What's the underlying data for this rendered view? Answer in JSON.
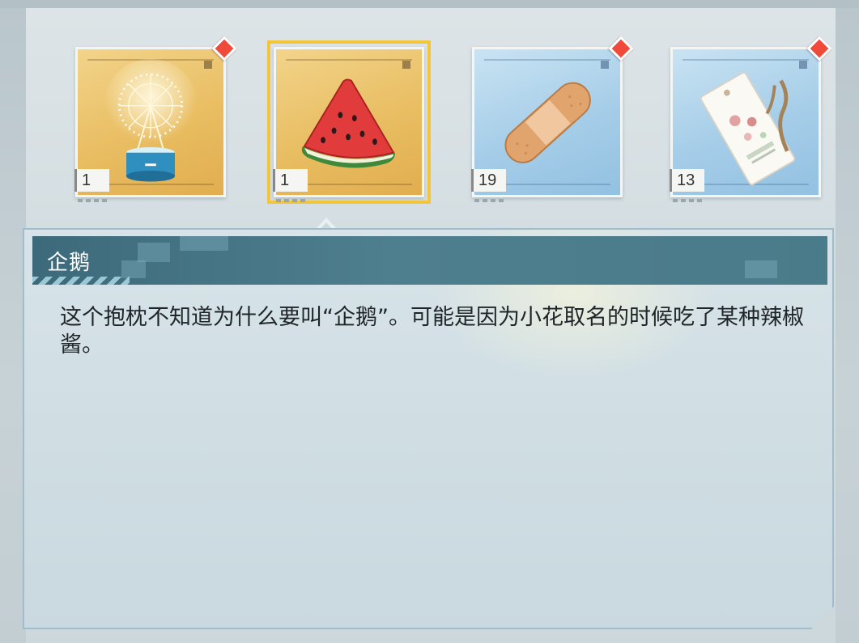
{
  "items": [
    {
      "name": "ferris-wheel-lamp",
      "count": "1",
      "rarity": "gold",
      "is_new": true,
      "selected": false
    },
    {
      "name": "watermelon-pillow",
      "count": "1",
      "rarity": "gold",
      "is_new": false,
      "selected": true
    },
    {
      "name": "bandage",
      "count": "19",
      "rarity": "blue",
      "is_new": true,
      "selected": false
    },
    {
      "name": "ticket-tag",
      "count": "13",
      "rarity": "blue",
      "is_new": true,
      "selected": false
    }
  ],
  "detail": {
    "title": "企鹅",
    "description": "这个抱枕不知道为什么要叫“企鹅”。可能是因为小花取名的时候吃了某种辣椒酱。"
  },
  "colors": {
    "gold_rarity": "#e9bd62",
    "blue_rarity": "#a5cde8",
    "selected_outline": "#f3c53a",
    "new_badge": "#ef4a3a",
    "header_bar": "#4e7f8f"
  }
}
